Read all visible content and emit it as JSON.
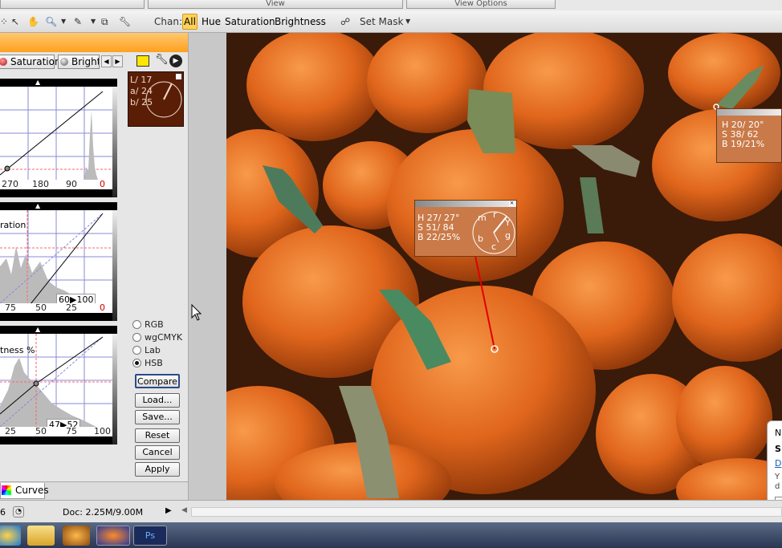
{
  "top_menu": {
    "view": "View",
    "view_options": "View Options"
  },
  "toolbar": {
    "chan_label": "Chan:",
    "channels": [
      "All",
      "Hue",
      "Saturation",
      "Brightness"
    ],
    "set_mask": "Set Mask"
  },
  "tabs": {
    "saturation": "Saturation",
    "brightness": "Brightr"
  },
  "curves": {
    "hue_ticks": [
      "270",
      "180",
      "90",
      "0"
    ],
    "sat_title": "ration",
    "sat_ticks": [
      "75",
      "50",
      "25",
      "0"
    ],
    "sat_readout": "60▶100",
    "bri_title": "tness %",
    "bri_ticks": [
      "25",
      "50",
      "75",
      "100"
    ],
    "bri_readout": "47▶52"
  },
  "swatch": {
    "l": "L/  17",
    "a": "a/  24",
    "b": "b/  25"
  },
  "color_modes": {
    "rgb": "RGB",
    "wgcmyk": "wgCMYK",
    "lab": "Lab",
    "hsb": "HSB",
    "selected": "HSB"
  },
  "buttons": {
    "compare": "Compare",
    "load": "Load...",
    "save": "Save...",
    "reset": "Reset",
    "cancel": "Cancel",
    "apply": "Apply"
  },
  "bottom_tab": "Curves",
  "statusbar": {
    "zoom": "6",
    "doc": "Doc: 2.25M/9.00M"
  },
  "info_main": {
    "h": "H   27/ 27°",
    "s": "S   51/  84",
    "b": "B   22/25%",
    "wheel": [
      "m",
      "r",
      "Y",
      "g",
      "c",
      "b"
    ]
  },
  "info_right": {
    "h": "H   20/ 20°",
    "s": "S   38/  62",
    "b": "B   19/21%"
  },
  "notification": {
    "n": "N",
    "s": "S",
    "d": "D",
    "y": "Y",
    "d2": "d"
  },
  "colors": {
    "panel_orange": "#ffa020",
    "swatch": "#5a1e06",
    "info_bg": "#c97a48",
    "probe_line": "#e00000"
  }
}
